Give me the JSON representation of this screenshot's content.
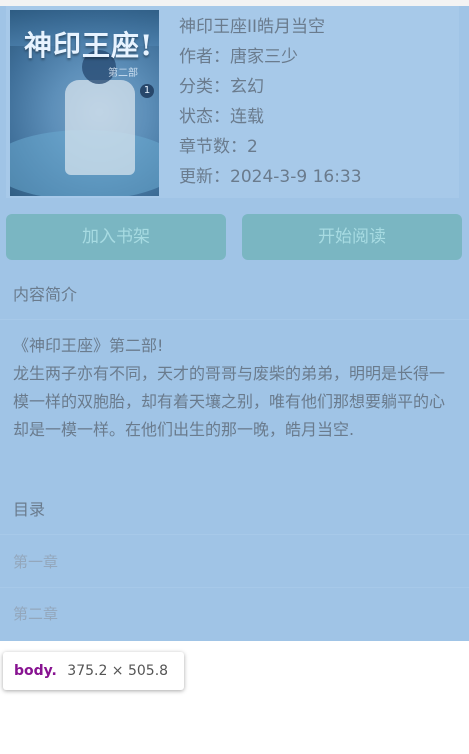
{
  "book": {
    "cover_title": "神印王座!",
    "cover_sub": "第二部",
    "cover_vol": "1",
    "title": "神印王座II皓月当空",
    "author_label": "作者：",
    "author": "唐家三少",
    "category_label": "分类：",
    "category": "玄幻",
    "status_label": "状态：",
    "status": "连载",
    "chapters_label": "章节数：",
    "chapters": "2",
    "updated_label": "更新：",
    "updated": "2024-3-9 16:33"
  },
  "actions": {
    "add_label": "加入书架",
    "read_label": "开始阅读"
  },
  "intro": {
    "heading": "内容简介",
    "text": "《神印王座》第二部!\n龙生两子亦有不同，天才的哥哥与废柴的弟弟，明明是长得一模一样的双胞胎，却有着天壤之别，唯有他们那想要躺平的心却是一模一样。在他们出生的那一晚，皓月当空."
  },
  "toc": {
    "heading": "目录",
    "items": [
      "第一章",
      "第二章"
    ]
  },
  "devtools_tip": {
    "tag": "body.",
    "dims": "375.2 × 505.8"
  }
}
